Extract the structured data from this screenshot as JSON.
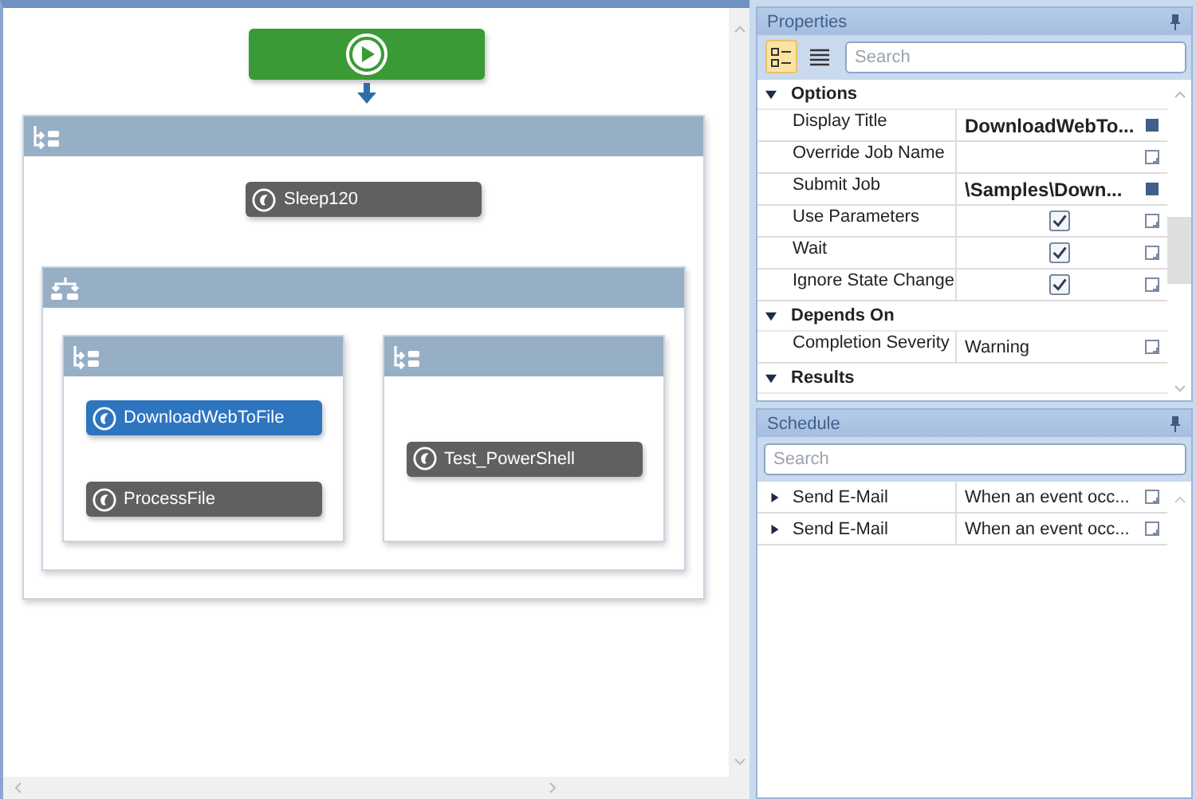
{
  "canvas": {
    "start": {
      "kind": "start"
    },
    "sequence": {
      "nodes": [
        {
          "label": "Sleep120",
          "selected": false
        }
      ],
      "parallel": {
        "branches": [
          {
            "nodes": [
              {
                "label": "DownloadWebToFile",
                "selected": true
              },
              {
                "label": "ProcessFile",
                "selected": false
              }
            ]
          },
          {
            "nodes": [
              {
                "label": "Test_PowerShell",
                "selected": false
              }
            ]
          }
        ]
      }
    }
  },
  "properties": {
    "title": "Properties",
    "view_buttons": [
      {
        "kind": "categorized",
        "selected": true
      },
      {
        "kind": "alphabetical",
        "selected": false
      }
    ],
    "search": {
      "placeholder": "Search"
    },
    "categories": [
      {
        "name": "Options",
        "expanded": true,
        "rows": [
          {
            "name": "Display Title",
            "kind": "text",
            "value": "DownloadWebTo...",
            "modified": true
          },
          {
            "name": "Override Job Name",
            "kind": "text",
            "modified": false
          },
          {
            "name": "Submit Job",
            "kind": "text",
            "value": "\\Samples\\Down...",
            "modified": true
          },
          {
            "name": "Use Parameters",
            "kind": "checkbox",
            "checked": true,
            "modified": false
          },
          {
            "name": "Wait",
            "kind": "checkbox",
            "checked": true,
            "modified": false
          },
          {
            "name": "Ignore State Change",
            "kind": "checkbox",
            "checked": true,
            "modified": false
          }
        ]
      },
      {
        "name": "Depends On",
        "expanded": true,
        "rows": [
          {
            "name": "Completion Severity",
            "kind": "text",
            "value": "Warning",
            "modified": false
          }
        ]
      },
      {
        "name": "Results",
        "expanded": true
      }
    ]
  },
  "schedule": {
    "title": "Schedule",
    "search": {
      "placeholder": "Search"
    },
    "rows": [
      {
        "name": "Send E-Mail",
        "value": "When an event occ...",
        "expanded": false
      },
      {
        "name": "Send E-Mail",
        "value": "When an event occ...",
        "expanded": false
      }
    ]
  }
}
